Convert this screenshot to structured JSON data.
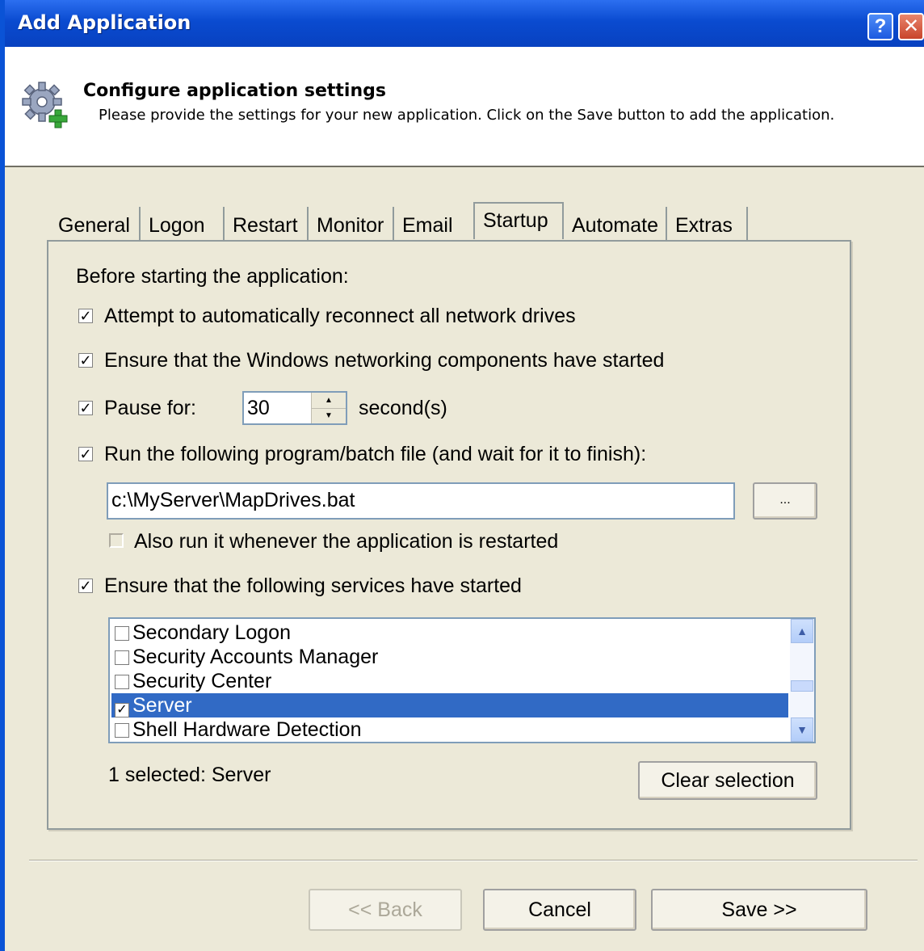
{
  "window": {
    "title": "Add Application",
    "help_button": "?",
    "close_button": "✕"
  },
  "header": {
    "title": "Configure application settings",
    "subtitle": "Please provide the settings for your new application. Click on the Save button to add the application."
  },
  "tabs": [
    {
      "label": "General"
    },
    {
      "label": "Logon"
    },
    {
      "label": "Restart"
    },
    {
      "label": "Monitor"
    },
    {
      "label": "Email"
    },
    {
      "label": "Startup",
      "active": true
    },
    {
      "label": "Automate"
    },
    {
      "label": "Extras"
    }
  ],
  "startup": {
    "intro": "Before starting the application:",
    "reconnect_drives": {
      "label": "Attempt to automatically reconnect all network drives",
      "checked": true
    },
    "ensure_networking": {
      "label": "Ensure that the Windows networking components have started",
      "checked": true
    },
    "pause": {
      "label": "Pause for:",
      "checked": true,
      "value": "30",
      "unit": "second(s)"
    },
    "run_program": {
      "label": "Run the following program/batch file (and wait for it to finish):",
      "checked": true
    },
    "program_path": "c:\\MyServer\\MapDrives.bat",
    "browse_label": "...",
    "also_run": {
      "label": "Also run it whenever the application is restarted",
      "checked": false
    },
    "ensure_services": {
      "label": "Ensure that the following services have started",
      "checked": true
    },
    "services": [
      {
        "label": "Secondary Logon",
        "checked": false
      },
      {
        "label": "Security Accounts Manager",
        "checked": false
      },
      {
        "label": "Security Center",
        "checked": false
      },
      {
        "label": "Server",
        "checked": true,
        "selected": true
      },
      {
        "label": "Shell Hardware Detection",
        "checked": false
      }
    ],
    "selection_status": "1 selected: Server",
    "clear_label": "Clear selection"
  },
  "footer": {
    "back_label": "<< Back",
    "cancel_label": "Cancel",
    "save_label": "Save >>"
  },
  "colors": {
    "title_bar": "#0a4bd0",
    "selection": "#316ac5",
    "dialog_bg": "#ece9d8"
  }
}
